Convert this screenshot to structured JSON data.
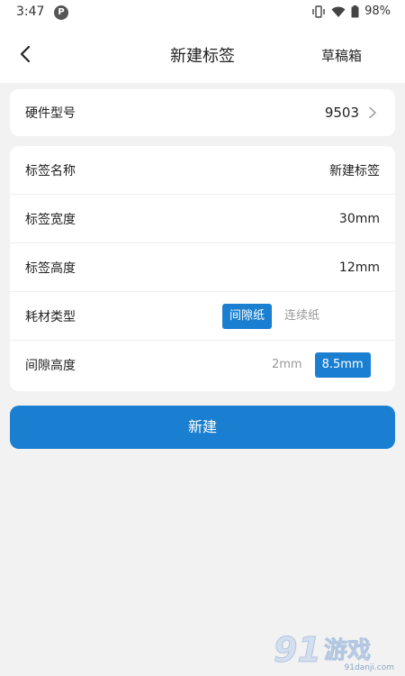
{
  "status_bar": {
    "time": "3:47",
    "app_icon": "P",
    "battery": "98%"
  },
  "nav": {
    "title": "新建标签",
    "drafts_label": "草稿箱"
  },
  "hardware": {
    "label": "硬件型号",
    "value": "9503"
  },
  "form": {
    "name": {
      "label": "标签名称",
      "value": "新建标签"
    },
    "width": {
      "label": "标签宽度",
      "value": "30mm"
    },
    "height": {
      "label": "标签高度",
      "value": "12mm"
    },
    "consumable": {
      "label": "耗材类型",
      "options": [
        "间隙纸",
        "连续纸"
      ],
      "selected": 0
    },
    "gap": {
      "label": "间隙高度",
      "options": [
        "2mm",
        "8.5mm"
      ],
      "selected": 1
    }
  },
  "create_label": "新建",
  "watermark": {
    "logo_text": "91游戏",
    "site": "91danji.com"
  },
  "colors": {
    "accent": "#1a7fd0",
    "background": "#f2f2f2"
  }
}
